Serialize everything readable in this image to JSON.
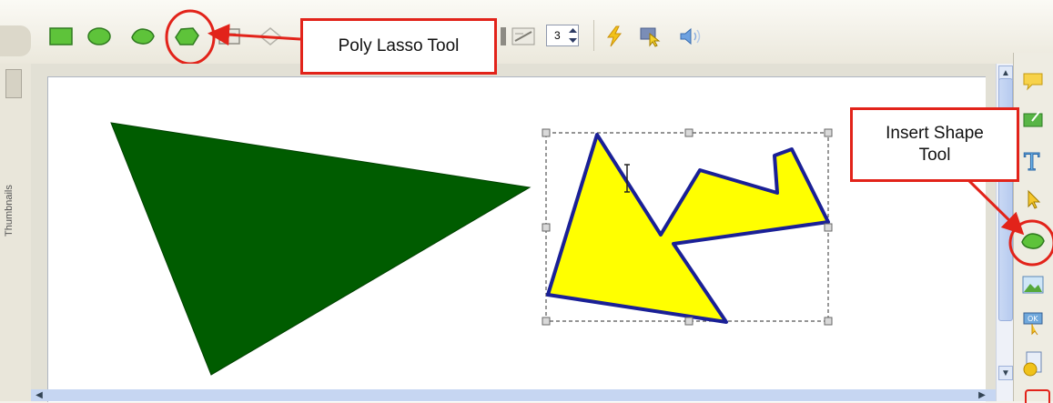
{
  "callouts": {
    "poly_lasso": "Poly Lasso Tool",
    "insert_shape_line1": "Insert Shape",
    "insert_shape_line2": "Tool"
  },
  "toolbar": {
    "spinner_value": "3"
  },
  "left_rail": {
    "label": "Thumbnails"
  },
  "colors": {
    "callout_border": "#e2231a",
    "triangle_fill": "#005c00",
    "polygon_fill": "#ffff00",
    "polygon_stroke": "#1a2096"
  },
  "icons": [
    "rectangle-shape-icon",
    "ellipse-shape-icon",
    "oval-shape-icon",
    "poly-lasso-icon",
    "speech-bubble-icon",
    "text-icon",
    "pointer-icon",
    "insert-shape-icon",
    "image-icon",
    "sound-icon"
  ]
}
